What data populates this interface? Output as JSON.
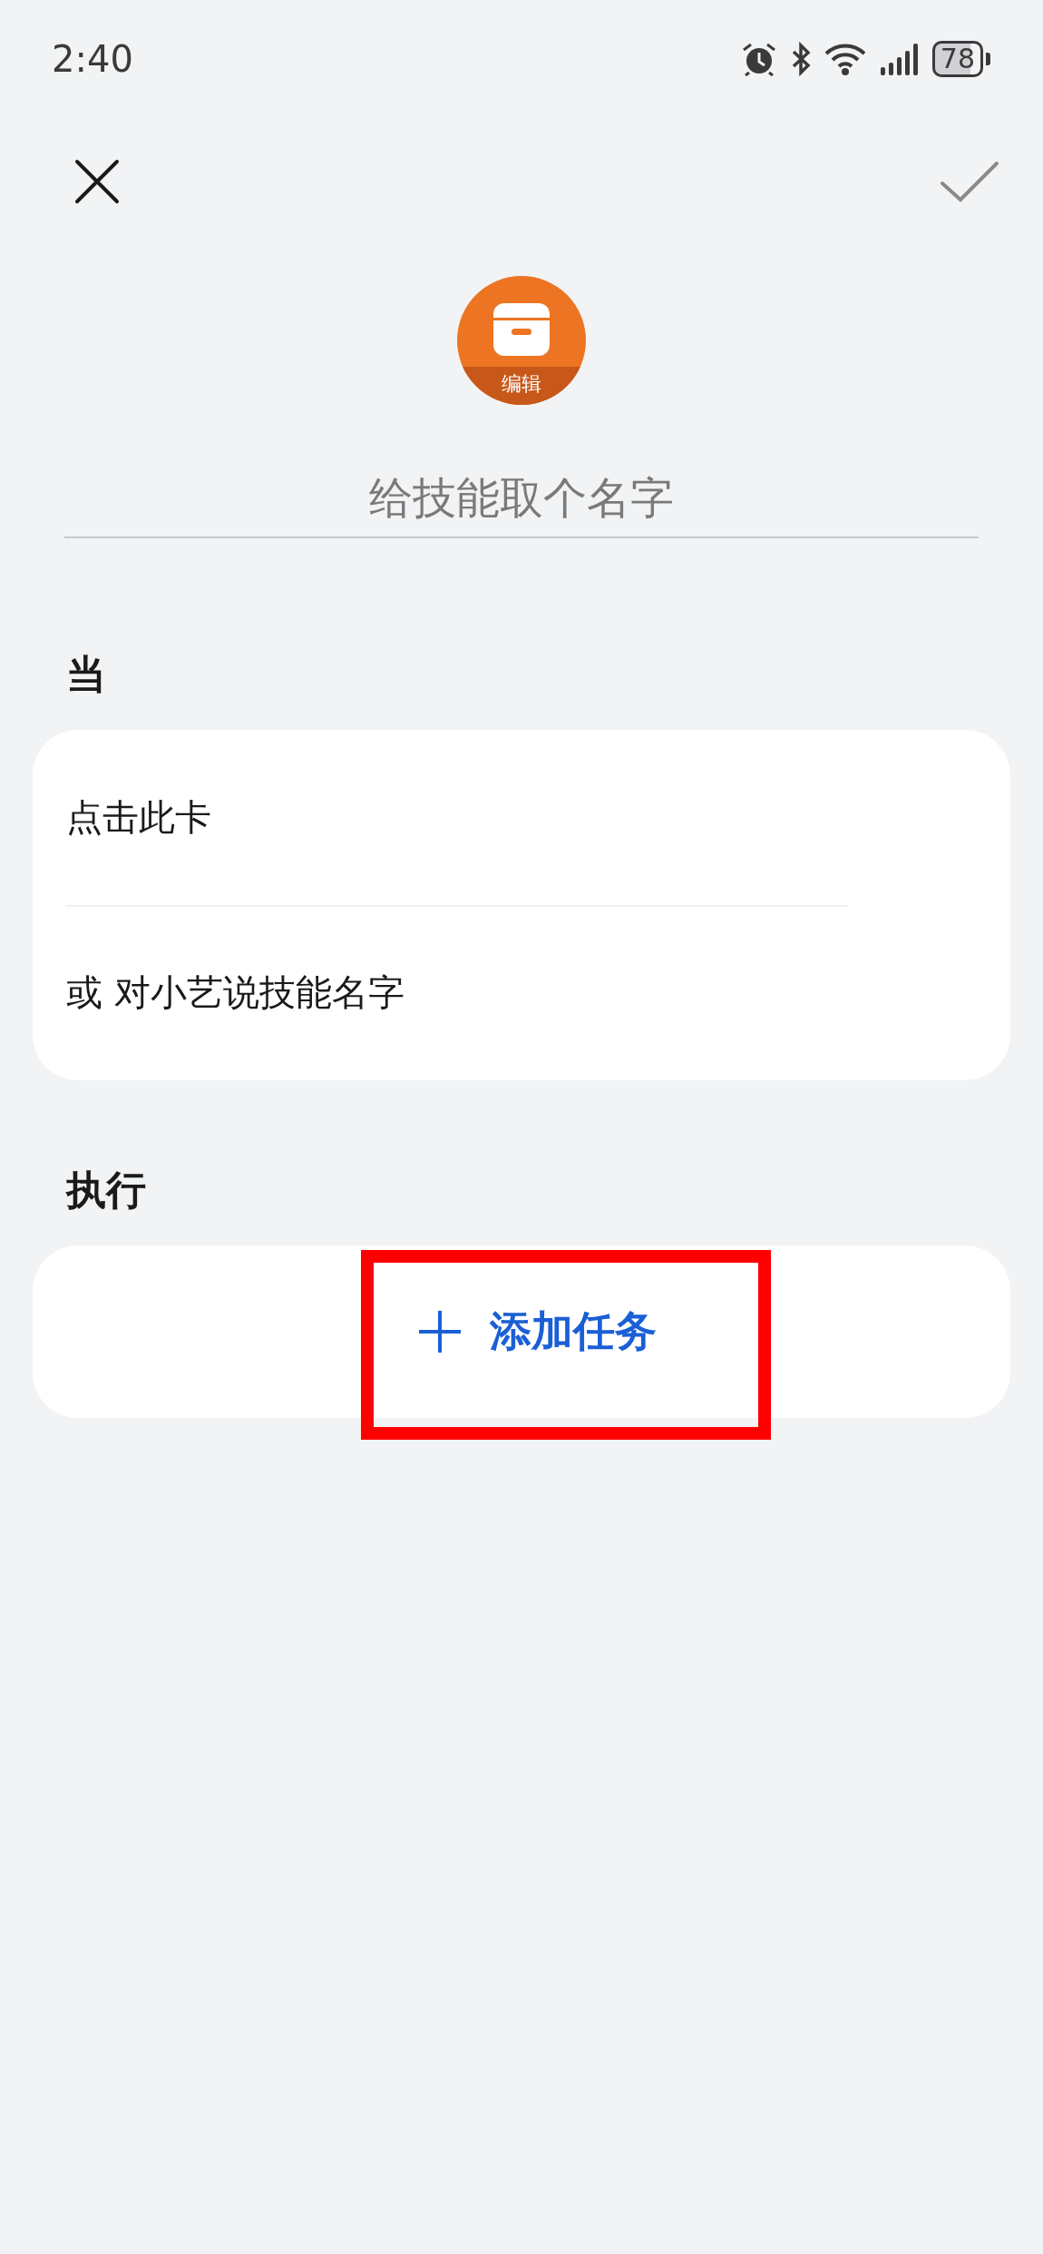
{
  "status_bar": {
    "time": "2:40",
    "battery": "78"
  },
  "avatar": {
    "label": "编辑"
  },
  "name_field": {
    "placeholder": "给技能取个名字"
  },
  "sections": [
    {
      "kind": "list",
      "title": "当",
      "items": [
        {
          "text": "点击此卡"
        },
        {
          "text": "或 对小艺说技能名字"
        }
      ]
    },
    {
      "kind": "action",
      "title": "执行",
      "action": {
        "label": "添加任务",
        "highlighted": true
      }
    }
  ]
}
